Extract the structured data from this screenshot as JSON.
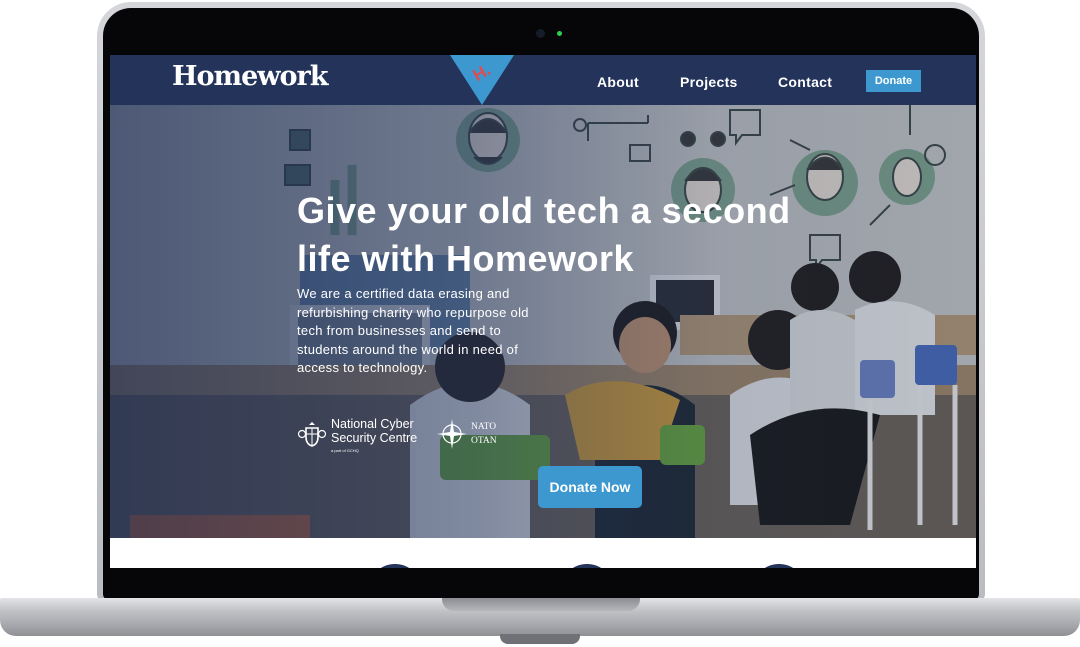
{
  "header": {
    "logo": "Homework",
    "badge_letter": "H.",
    "nav": [
      "About",
      "Projects",
      "Contact"
    ],
    "donate_label": "Donate"
  },
  "hero": {
    "title": "Give your old tech a second life with Homework",
    "description": "We are a certified data erasing and refurbishing charity who repurpose old tech from businesses and send to students around the world in need of access to technology.",
    "partners": {
      "ncsc_line1": "National Cyber",
      "ncsc_line2": "Security Centre",
      "ncsc_sub": "a part of GCHQ",
      "nato_line1": "NATO",
      "nato_line2": "OTAN"
    },
    "cta_label": "Donate Now"
  },
  "colors": {
    "navy": "#23335a",
    "accent_blue": "#3c98cf",
    "badge_red": "#e24b50"
  }
}
